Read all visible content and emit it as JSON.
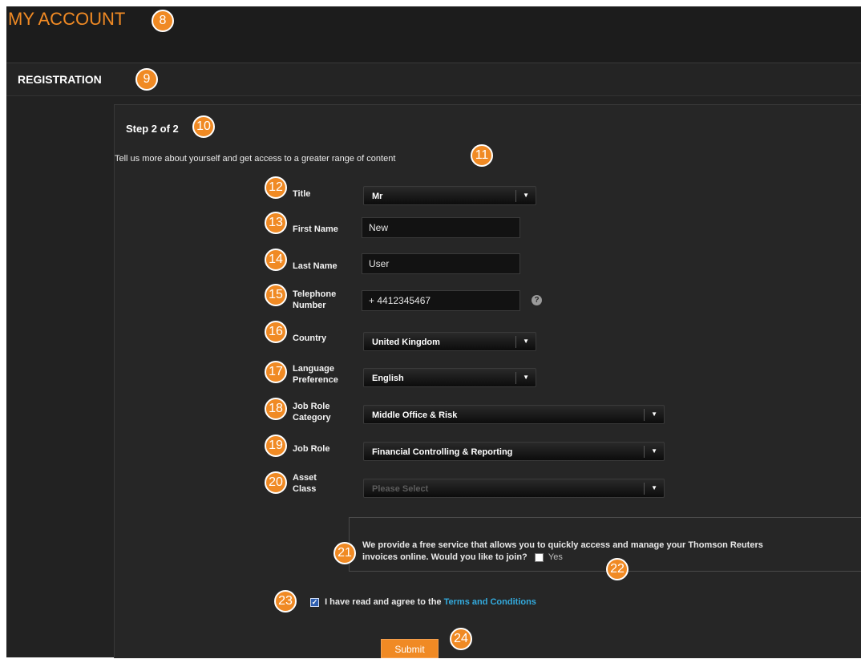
{
  "header": {
    "title": "MY ACCOUNT"
  },
  "section": {
    "title": "REGISTRATION"
  },
  "form": {
    "step": "Step 2 of 2",
    "intro": "Tell us more about yourself and get access to a greater range of content",
    "fields": {
      "title": {
        "label": "Title",
        "value": "Mr"
      },
      "first_name": {
        "label": "First Name",
        "value": "New"
      },
      "last_name": {
        "label": "Last Name",
        "value": "User"
      },
      "telephone": {
        "label_line1": "Telephone",
        "label_line2": "Number",
        "value": "+ 4412345467",
        "help": "?"
      },
      "country": {
        "label": "Country",
        "value": "United Kingdom"
      },
      "language": {
        "label_line1": "Language",
        "label_line2": "Preference",
        "value": "English"
      },
      "job_role_category": {
        "label_line1": "Job Role",
        "label_line2": "Category",
        "value": "Middle Office & Risk"
      },
      "job_role": {
        "label": "Job Role",
        "value": "Financial Controlling & Reporting"
      },
      "asset_class": {
        "label_line1": "Asset",
        "label_line2": "Class",
        "placeholder": "Please Select"
      }
    },
    "invoice": {
      "text_line1": "We provide a free service that allows you to quickly access and manage your Thomson Reuters",
      "text_line2": "invoices online. Would you like to join?",
      "yes_label": "Yes",
      "checked": false
    },
    "terms": {
      "text": "I have read and agree to the",
      "link": "Terms and Conditions",
      "checked": true
    },
    "submit_label": "Submit"
  },
  "annotations": [
    "8",
    "9",
    "10",
    "11",
    "12",
    "13",
    "14",
    "15",
    "16",
    "17",
    "18",
    "19",
    "20",
    "21",
    "22",
    "23",
    "24"
  ],
  "colors": {
    "accent": "#f08a24",
    "background": "#222222",
    "link": "#33aadd"
  }
}
